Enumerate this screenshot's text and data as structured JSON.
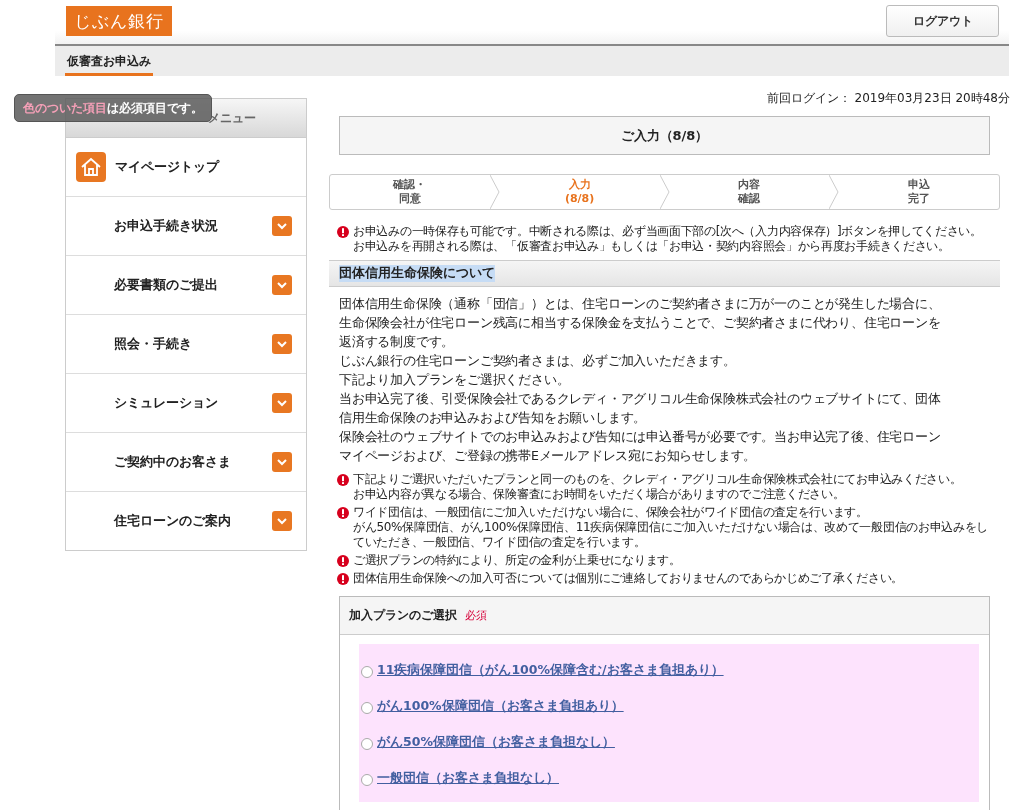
{
  "header": {
    "logo": "じぶん銀行",
    "logout_button": "ログアウト"
  },
  "nav": {
    "tabs": [
      {
        "label": "仮審査お申込み",
        "selected": true
      }
    ]
  },
  "tooltip": {
    "highlight": "色のついた項目",
    "text": "は必須項目です。"
  },
  "sidebar": {
    "title": "メニュー",
    "top_item": "マイページトップ",
    "items": [
      {
        "label": "お申込手続き状況",
        "expanded": false
      },
      {
        "label": "必要書類のご提出",
        "expanded": false
      },
      {
        "label": "照会・手続き",
        "expanded": false
      },
      {
        "label": "シミュレーション",
        "expanded": false
      },
      {
        "label": "ご契約中のお客さま",
        "expanded": false
      },
      {
        "label": "住宅ローンのご案内",
        "expanded": false
      }
    ]
  },
  "last_login": {
    "label": "前回ログイン：",
    "value": "2019年03月23日 20時48分"
  },
  "page_title": "ご入力（8/8）",
  "steps": [
    {
      "lines": [
        "確認・",
        "同意"
      ],
      "selected": false
    },
    {
      "lines": [
        "入力",
        "(8/8)"
      ],
      "selected": true
    },
    {
      "lines": [
        "内容",
        "確認"
      ],
      "selected": false
    },
    {
      "lines": [
        "申込",
        "完了"
      ],
      "selected": false
    }
  ],
  "save_notice": [
    "お申込みの一時保存も可能です。中断される際は、必ず当画面下部の[次へ（入力内容保存）]ボタンを押してください。",
    "お申込みを再開される際は、「仮審査お申込み」もしくは「お申込・契約内容照会」から再度お手続きください。"
  ],
  "section": {
    "heading": "団体信用生命保険について",
    "body": [
      "団体信用生命保険（通称「団信」）とは、住宅ローンのご契約者さまに万が一のことが発生した場合に、",
      "生命保険会社が住宅ローン残高に相当する保険金を支払うことで、ご契約者さまに代わり、住宅ローンを",
      "返済する制度です。",
      "じぶん銀行の住宅ローンご契約者さまは、必ずご加入いただきます。",
      "下記より加入プランをご選択ください。",
      "当お申込完了後、引受保険会社であるクレディ・アグリコル生命保険株式会社のウェブサイトにて、団体",
      "信用生命保険のお申込みおよび告知をお願いします。",
      "保険会社のウェブサイトでのお申込みおよび告知には申込番号が必要です。当お申込完了後、住宅ローン",
      "マイページおよび、ご登録の携帯Eメールアドレス宛にお知らせします。"
    ],
    "notes": [
      [
        "下記よりご選択いただいたプランと同一のものを、クレディ・アグリコル生命保険株式会社にてお申込みください。",
        "お申込内容が異なる場合、保険審査にお時間をいただく場合がありますのでご注意ください。"
      ],
      [
        "ワイド団信は、一般団信にご加入いただけない場合に、保険会社がワイド団信の査定を行います。",
        "がん50%保障団信、がん100%保障団信、11疾病保障団信にご加入いただけない場合は、改めて一般団信のお申込みをし",
        "ていただき、一般団信、ワイド団信の査定を行います。"
      ],
      [
        "ご選択プランの特約により、所定の金利が上乗せになります。"
      ],
      [
        "団体信用生命保険への加入可否については個別にご連絡しておりませんのであらかじめご了承ください。"
      ]
    ]
  },
  "plan": {
    "title": "加入プランのご選択",
    "required": "必須",
    "options": [
      {
        "label": "11疾病保障団信（がん100%保障含む/お客さま負担あり）",
        "selected": false
      },
      {
        "label": "がん100%保障団信（お客さま負担あり）",
        "selected": false
      },
      {
        "label": "がん50%保障団信（お客さま負担なし）",
        "selected": false
      },
      {
        "label": "一般団信（お客さま負担なし）",
        "selected": false
      }
    ]
  }
}
